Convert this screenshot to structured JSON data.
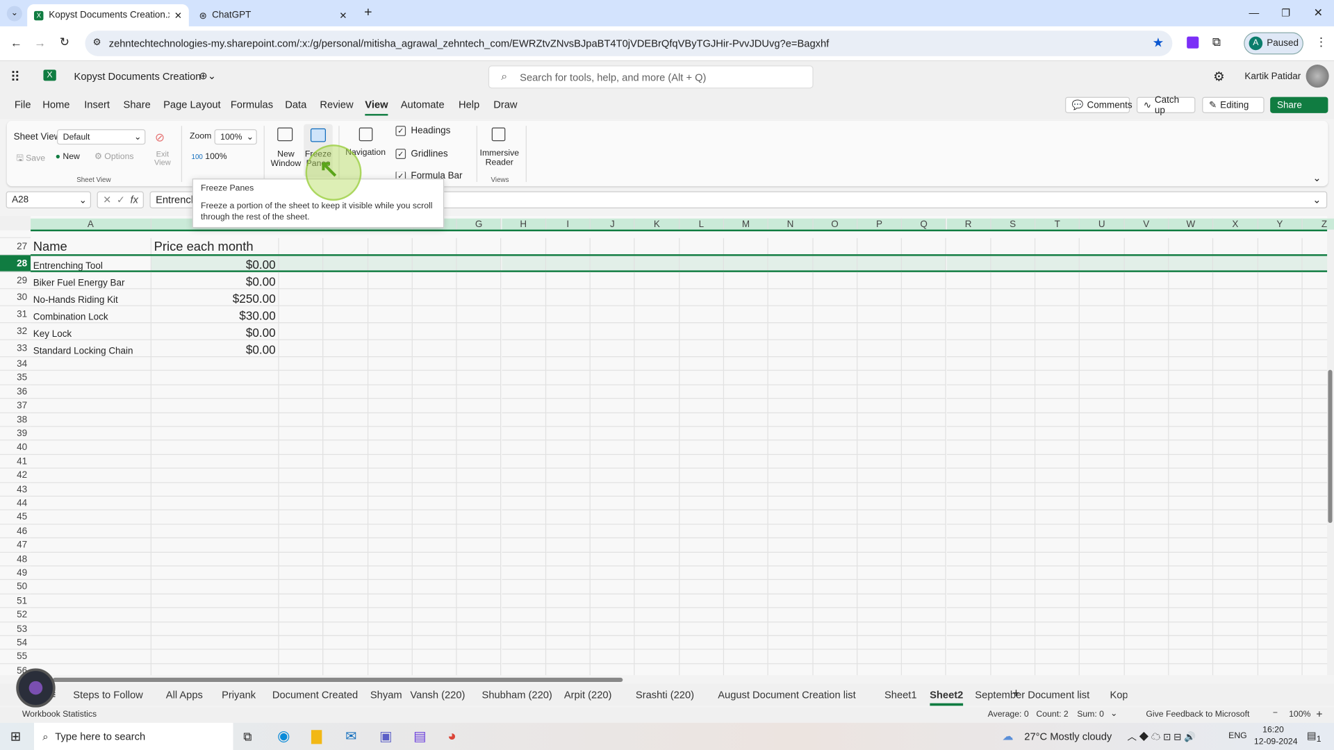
{
  "browser": {
    "tabs": [
      {
        "label": "Kopyst Documents Creation.xlsx",
        "active": true
      },
      {
        "label": "ChatGPT",
        "active": false
      }
    ],
    "url": "zehntechtechnologies-my.sharepoint.com/:x:/g/personal/mitisha_agrawal_zehntech_com/EWRZtvZNvsBJpaBT4T0jVDEBrQfqVByTGJHir-PvvJDUvg?e=Bagxhf",
    "profile_label": "Paused",
    "profile_initial": "A"
  },
  "app": {
    "title": "Kopyst Documents Creation",
    "search_placeholder": "Search for tools, help, and more (Alt + Q)",
    "user": "Kartik Patidar"
  },
  "menu": {
    "items": [
      "File",
      "Home",
      "Insert",
      "Share",
      "Page Layout",
      "Formulas",
      "Data",
      "Review",
      "View",
      "Automate",
      "Help",
      "Draw"
    ],
    "active": "View",
    "comments": "Comments",
    "catchup": "Catch up",
    "editing": "Editing",
    "share": "Share"
  },
  "ribbon": {
    "sheet_view_label": "Sheet View",
    "sheet_view_value": "Default",
    "save": "Save",
    "new": "New",
    "options": "Options",
    "exit_view": "Exit View",
    "group_sheet_view": "Sheet View",
    "zoom_label": "Zoom",
    "zoom_value": "100%",
    "zoom_100": "100%",
    "new_window": "New Window",
    "freeze_panes": "Freeze Panes",
    "navigation": "Navigation",
    "headings": "Headings",
    "gridlines": "Gridlines",
    "formula_bar": "Formula Bar",
    "immersive_reader": "Immersive Reader",
    "group_views": "Views"
  },
  "tooltip": {
    "title": "Freeze Panes",
    "body": "Freeze a portion of the sheet to keep it visible while you scroll through the rest of the sheet."
  },
  "formula": {
    "name_box": "A28",
    "content": "Entrenching Tool"
  },
  "sheet": {
    "columns": [
      "A",
      "B",
      "C",
      "D",
      "E",
      "F",
      "G",
      "H",
      "I",
      "J",
      "K",
      "L",
      "M",
      "N",
      "O",
      "P",
      "Q",
      "R",
      "S",
      "T",
      "U",
      "V",
      "W",
      "X",
      "Y",
      "Z"
    ],
    "selected_row": 28,
    "rows": [
      {
        "n": 27,
        "a": "Name",
        "b": "Price each month",
        "header": true
      },
      {
        "n": 28,
        "a": "Entrenching Tool",
        "b": "$0.00"
      },
      {
        "n": 29,
        "a": "Biker Fuel Energy Bar",
        "b": "$0.00"
      },
      {
        "n": 30,
        "a": "No-Hands Riding Kit",
        "b": "$250.00"
      },
      {
        "n": 31,
        "a": "Combination Lock",
        "b": "$30.00"
      },
      {
        "n": 32,
        "a": "Key Lock",
        "b": "$0.00"
      },
      {
        "n": 33,
        "a": "Standard Locking Chain",
        "b": "$0.00"
      }
    ],
    "empty_rows_from": 34,
    "empty_rows_to": 56
  },
  "sheet_tabs": {
    "tabs": [
      "Steps to Follow",
      "All Apps",
      "Priyank",
      "Document Created",
      "Shyam",
      "Vansh (220)",
      "Shubham (220)",
      "Arpit (220)",
      "Srashti (220)",
      "August Document Creation list",
      "Sheet1",
      "Sheet2",
      "September Document list",
      "Kop"
    ],
    "active": "Sheet2"
  },
  "status": {
    "left": "Workbook Statistics",
    "average": "Average: 0",
    "count": "Count: 2",
    "sum": "Sum: 0",
    "feedback": "Give Feedback to Microsoft",
    "zoom": "100%"
  },
  "taskbar": {
    "search": "Type here to search",
    "weather": "27°C  Mostly cloudy",
    "lang": "ENG",
    "time": "16:20",
    "date": "12-09-2024",
    "notifications": "1"
  },
  "colors": {
    "accent": "#107c41",
    "selection": "#e2efe8",
    "header_sel": "#caead8"
  }
}
